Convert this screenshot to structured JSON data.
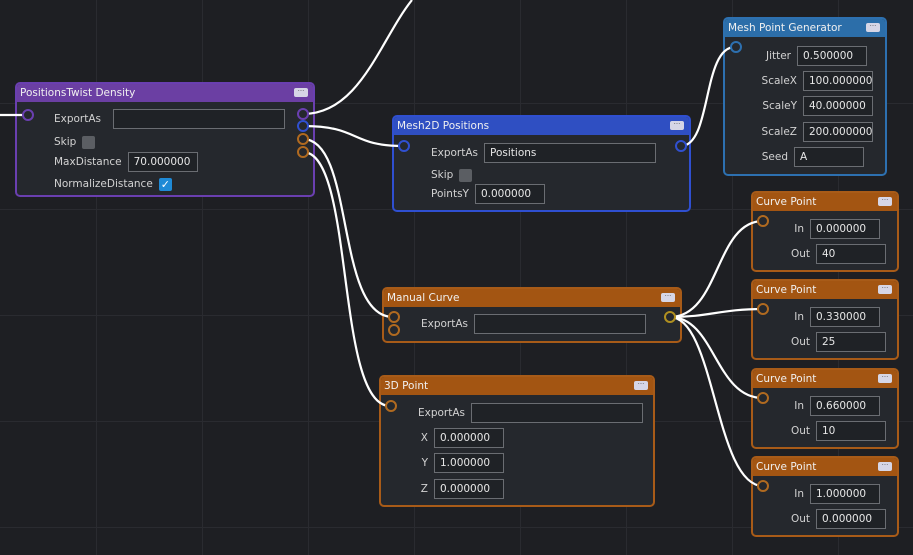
{
  "nodes": {
    "twist": {
      "title": "PositionsTwist Density",
      "export_label": "ExportAs",
      "export_value": "",
      "skip_label": "Skip",
      "skip": false,
      "maxdist_label": "MaxDistance",
      "maxdist": "70.000000",
      "normalize_label": "NormalizeDistance",
      "normalize": true
    },
    "mesh2d": {
      "title": "Mesh2D Positions",
      "export_label": "ExportAs",
      "export_value": "Positions",
      "skip_label": "Skip",
      "skip": false,
      "pointsy_label": "PointsY",
      "pointsy": "0.000000"
    },
    "meshgen": {
      "title": "Mesh Point Generator",
      "jitter_label": "Jitter",
      "jitter": "0.500000",
      "scalex_label": "ScaleX",
      "scalex": "100.000000",
      "scaley_label": "ScaleY",
      "scaley": "40.000000",
      "scalez_label": "ScaleZ",
      "scalez": "200.000000",
      "seed_label": "Seed",
      "seed": "A"
    },
    "curve": {
      "title": "Manual Curve",
      "export_label": "ExportAs",
      "export_value": ""
    },
    "point3d": {
      "title": "3D Point",
      "export_label": "ExportAs",
      "export_value": "",
      "x_label": "X",
      "x": "0.000000",
      "y_label": "Y",
      "y": "1.000000",
      "z_label": "Z",
      "z": "0.000000"
    },
    "curve_points": [
      {
        "title": "Curve Point",
        "in_label": "In",
        "in": "0.000000",
        "out_label": "Out",
        "out": "40"
      },
      {
        "title": "Curve Point",
        "in_label": "In",
        "in": "0.330000",
        "out_label": "Out",
        "out": "25"
      },
      {
        "title": "Curve Point",
        "in_label": "In",
        "in": "0.660000",
        "out_label": "Out",
        "out": "10"
      },
      {
        "title": "Curve Point",
        "in_label": "In",
        "in": "1.000000",
        "out_label": "Out",
        "out": "0.000000"
      }
    ]
  },
  "colors": {
    "purple": "#6b3fa3",
    "blue": "#2f4fc2",
    "steel": "#2c6ea9",
    "orange": "#a35512",
    "wire": "#ffffff"
  }
}
